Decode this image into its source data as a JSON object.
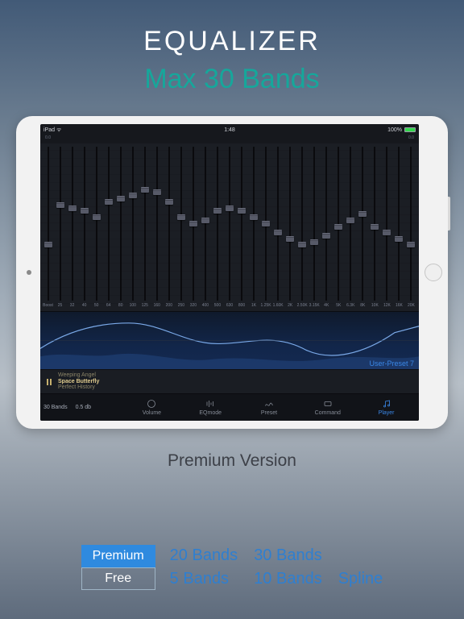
{
  "headline": {
    "title": "EQUALIZER",
    "subtitle": "Max 30 Bands"
  },
  "statusbar": {
    "left": "iPad ᯤ",
    "center": "1:48",
    "right_pct": "100%"
  },
  "eq": {
    "db_labels": [
      "0.0",
      "",
      "",
      "",
      "",
      "",
      "",
      "",
      "",
      "",
      "",
      "",
      "",
      "",
      "",
      "",
      "",
      "",
      "",
      "",
      "",
      "",
      "",
      "",
      "",
      "",
      "",
      "",
      "",
      "",
      "0.0"
    ],
    "bands": [
      {
        "freq": "Boost",
        "pos": 62
      },
      {
        "freq": "25",
        "pos": 36
      },
      {
        "freq": "32",
        "pos": 38
      },
      {
        "freq": "40",
        "pos": 40
      },
      {
        "freq": "50",
        "pos": 44
      },
      {
        "freq": "64",
        "pos": 34
      },
      {
        "freq": "80",
        "pos": 32
      },
      {
        "freq": "100",
        "pos": 30
      },
      {
        "freq": "125",
        "pos": 26
      },
      {
        "freq": "160",
        "pos": 28
      },
      {
        "freq": "200",
        "pos": 34
      },
      {
        "freq": "250",
        "pos": 44
      },
      {
        "freq": "320",
        "pos": 48
      },
      {
        "freq": "400",
        "pos": 46
      },
      {
        "freq": "500",
        "pos": 40
      },
      {
        "freq": "630",
        "pos": 38
      },
      {
        "freq": "800",
        "pos": 40
      },
      {
        "freq": "1K",
        "pos": 44
      },
      {
        "freq": "1.25K",
        "pos": 48
      },
      {
        "freq": "1.60K",
        "pos": 54
      },
      {
        "freq": "2K",
        "pos": 58
      },
      {
        "freq": "2.50K",
        "pos": 62
      },
      {
        "freq": "3.15K",
        "pos": 60
      },
      {
        "freq": "4K",
        "pos": 56
      },
      {
        "freq": "5K",
        "pos": 50
      },
      {
        "freq": "6.3K",
        "pos": 46
      },
      {
        "freq": "8K",
        "pos": 42
      },
      {
        "freq": "10K",
        "pos": 50
      },
      {
        "freq": "12K",
        "pos": 54
      },
      {
        "freq": "16K",
        "pos": 58
      },
      {
        "freq": "20K",
        "pos": 62
      }
    ]
  },
  "spectrum": {
    "preset_label": "User-Preset 7"
  },
  "nowplaying": {
    "artist": "Weeping Angel",
    "title": "Space Butterfly",
    "album": "Perfect History"
  },
  "toolbar": {
    "bandcount": "30 Bands",
    "step": "0.5 db",
    "items": [
      {
        "key": "volume",
        "label": "Volume"
      },
      {
        "key": "eqmode",
        "label": "EQmode"
      },
      {
        "key": "preset",
        "label": "Preset"
      },
      {
        "key": "command",
        "label": "Command"
      },
      {
        "key": "player",
        "label": "Player",
        "active": true
      }
    ]
  },
  "caption": "Premium Version",
  "footer": {
    "tiers": {
      "premium": "Premium",
      "free": "Free"
    },
    "premium_bands": [
      "20 Bands",
      "30 Bands",
      ""
    ],
    "free_bands": [
      "5 Bands",
      "10 Bands",
      "Spline"
    ]
  }
}
